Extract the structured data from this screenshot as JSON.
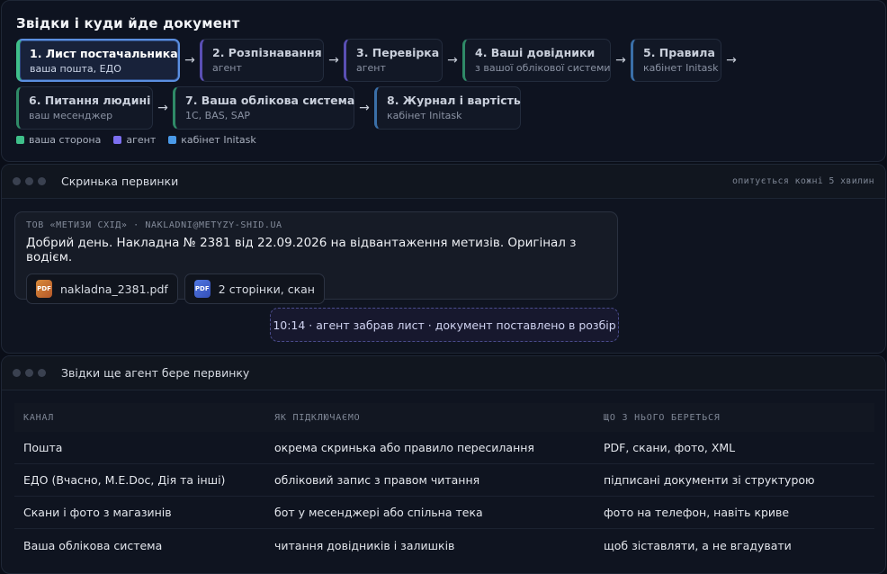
{
  "flow": {
    "title": "Звідки і куди йде документ",
    "steps": [
      {
        "title": "1. Лист постачальника",
        "sub": "ваша пошта, ЕДО"
      },
      {
        "title": "2. Розпізнавання",
        "sub": "агент"
      },
      {
        "title": "3. Перевірка",
        "sub": "агент"
      },
      {
        "title": "4. Ваші довідники",
        "sub": "з вашої облікової системи"
      },
      {
        "title": "5. Правила",
        "sub": "кабінет Initask"
      },
      {
        "title": "6. Питання людині",
        "sub": "ваш месенджер"
      },
      {
        "title": "7. Ваша облікова система",
        "sub": "1С, BAS, SAP"
      },
      {
        "title": "8. Журнал і вартість",
        "sub": "кабінет Initask"
      }
    ],
    "arrow": "→",
    "legend": [
      {
        "label": "ваша сторона",
        "color": "#3fbf8a"
      },
      {
        "label": "агент",
        "color": "#7c6ff0"
      },
      {
        "label": "кабінет Initask",
        "color": "#4a9ae8"
      }
    ]
  },
  "inbox": {
    "title": "Скринька первинки",
    "meta": "опитується кожні 5 хвилин",
    "email": {
      "sender": "ТОВ «МЕТИЗИ СХІД» · NAKLADNI@METYZY-SHID.UA",
      "body": "Добрий день. Накладна № 2381 від 22.09.2026 на відвантаження метизів. Оригінал з водієм.",
      "attachments": [
        {
          "badge": "PDF",
          "label": "nakladna_2381.pdf"
        },
        {
          "badge": "PDF",
          "label": "2 сторінки, скан"
        }
      ]
    },
    "status": "10:14 · агент забрав лист · документ поставлено в розбір"
  },
  "sources": {
    "title": "Звідки ще агент бере первинку",
    "headers": [
      "КАНАЛ",
      "ЯК ПІДКЛЮЧАЄМО",
      "ЩО З НЬОГО БЕРЕТЬСЯ"
    ],
    "rows": [
      [
        "Пошта",
        "окрема скринька або правило пересилання",
        "PDF, скани, фото, XML"
      ],
      [
        "ЕДО (Вчасно, M.E.Doc, Дія та інші)",
        "обліковий запис з правом читання",
        "підписані документи зі структурою"
      ],
      [
        "Скани і фото з магазинів",
        "бот у месенджері або спільна тека",
        "фото на телефон, навіть криве"
      ],
      [
        "Ваша облікова система",
        "читання довідників і залишків",
        "щоб зіставляти, а не вгадувати"
      ]
    ]
  }
}
